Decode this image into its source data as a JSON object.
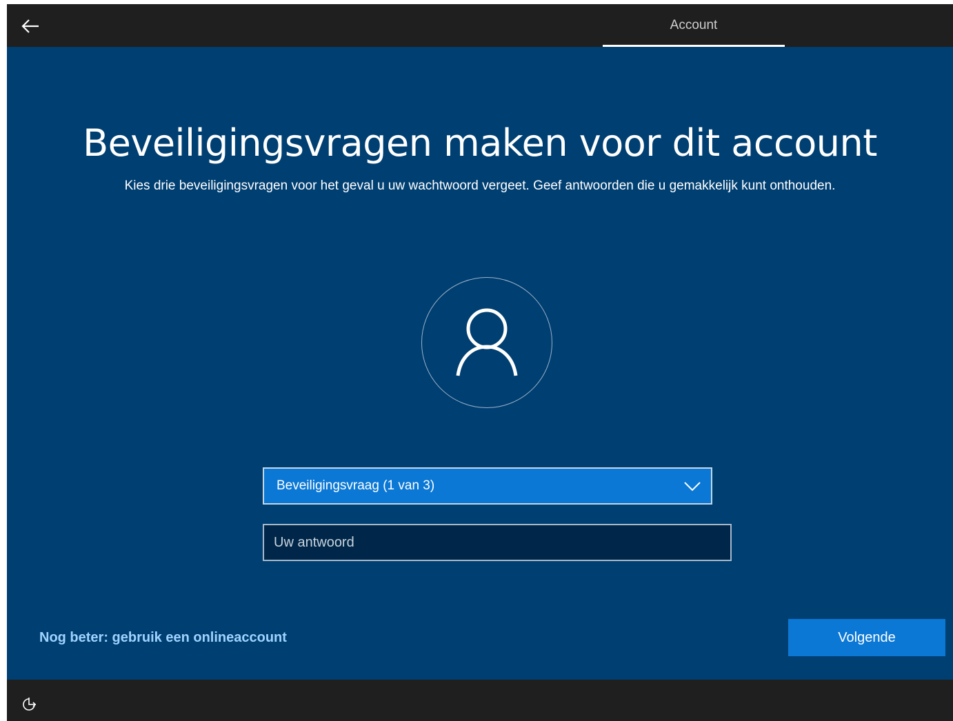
{
  "header": {
    "back_icon": "back-arrow-icon",
    "tab_label": "Account"
  },
  "main": {
    "title": "Beveiligingsvragen maken voor dit account",
    "subtitle": "Kies drie beveiligingsvragen voor het geval u uw wachtwoord vergeet. Geef antwoorden die u gemakkelijk kunt onthouden.",
    "avatar_icon": "user-icon",
    "security_question": {
      "selected": "Beveiligingsvraag (1 van 3)",
      "icon": "chevron-down-icon"
    },
    "answer": {
      "value": "",
      "placeholder": "Uw antwoord"
    }
  },
  "actions": {
    "online_account_link": "Nog beter: gebruik een onlineaccount",
    "next_label": "Volgende"
  },
  "footer": {
    "ease_of_access_icon": "ease-of-access-icon"
  },
  "colors": {
    "background": "#003f72",
    "bar": "#1f1f1f",
    "accent": "#0b78d6",
    "link": "#9fd3ff"
  }
}
